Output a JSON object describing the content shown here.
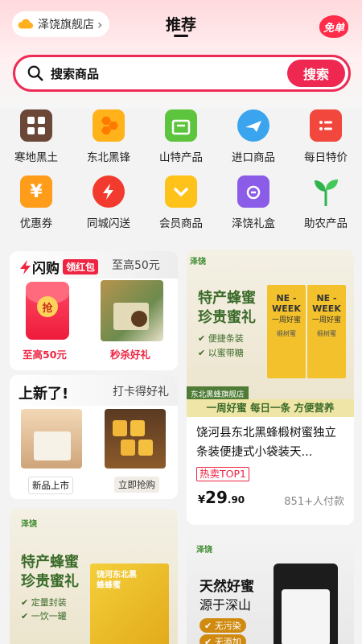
{
  "header": {
    "store": "泽饶旗舰店",
    "store_arrow": "›",
    "title": "推荐",
    "badge": "免单"
  },
  "search": {
    "placeholder": "搜索商品",
    "button": "搜索"
  },
  "categories": [
    {
      "label": "寒地黑土",
      "icon": "grid-icon",
      "color": "#6b4738"
    },
    {
      "label": "东北黑锋",
      "icon": "honeycomb-icon",
      "color": "#ffb21a"
    },
    {
      "label": "山特产品",
      "icon": "calendar-icon",
      "color": "#5cc53d"
    },
    {
      "label": "进口商品",
      "icon": "airplane-icon",
      "color": "#3aa4ee"
    },
    {
      "label": "每日特价",
      "icon": "list-icon",
      "color": "#f2473c"
    },
    {
      "label": "优惠券",
      "icon": "yen-icon",
      "color": "#ff9c1a"
    },
    {
      "label": "同城闪送",
      "icon": "lightning-icon",
      "color": "#f23a2e"
    },
    {
      "label": "会员商品",
      "icon": "chevron-down-icon",
      "color": "#ffc21a"
    },
    {
      "label": "泽饶礼盒",
      "icon": "gift-box-icon",
      "color": "#8b5ce8"
    },
    {
      "label": "助农产品",
      "icon": "sprout-icon",
      "color": "#2fb34a"
    }
  ],
  "flash": {
    "title": "闪购",
    "badge": "领红包",
    "max": "至高50元",
    "coupon_char": "抢",
    "item1_caption": "至高50元",
    "item2_caption": "秒杀好礼"
  },
  "newarrival": {
    "title": "上新了!",
    "sub": "打卡得好礼",
    "btn1": "新品上市",
    "btn2": "立即抢购"
  },
  "product1": {
    "logo": "泽饶",
    "banner_title1": "特产蜂蜜",
    "banner_title2": "珍贵蜜礼",
    "feature1": "便捷条装",
    "feature2": "以蜜带糖",
    "box_text1": "NE -WEEK",
    "box_text2": "一周好蜜",
    "box_small": "椴树蜜",
    "store_tag": "东北黑蜂旗舰店",
    "slogan": "一周好蜜 每日一条 方便营养",
    "name": "饶河县东北黑蜂椴树蜜独立条装便捷式小袋装天...",
    "hot": "热卖TOP1",
    "currency": "¥",
    "price_int": "29",
    "price_dec": ".90",
    "buyers": "851+人付款"
  },
  "product2": {
    "logo": "泽饶",
    "title1": "特产蜂蜜",
    "title2": "珍贵蜜礼",
    "feature1": "定量封装",
    "feature2": "一饮一罐",
    "box_text": "饶河东北黑蜂蜂蜜"
  },
  "product3": {
    "logo": "泽饶",
    "title1": "天然好蜜",
    "title2": "源于深山",
    "feature1": "无污染",
    "feature2": "无添加"
  }
}
